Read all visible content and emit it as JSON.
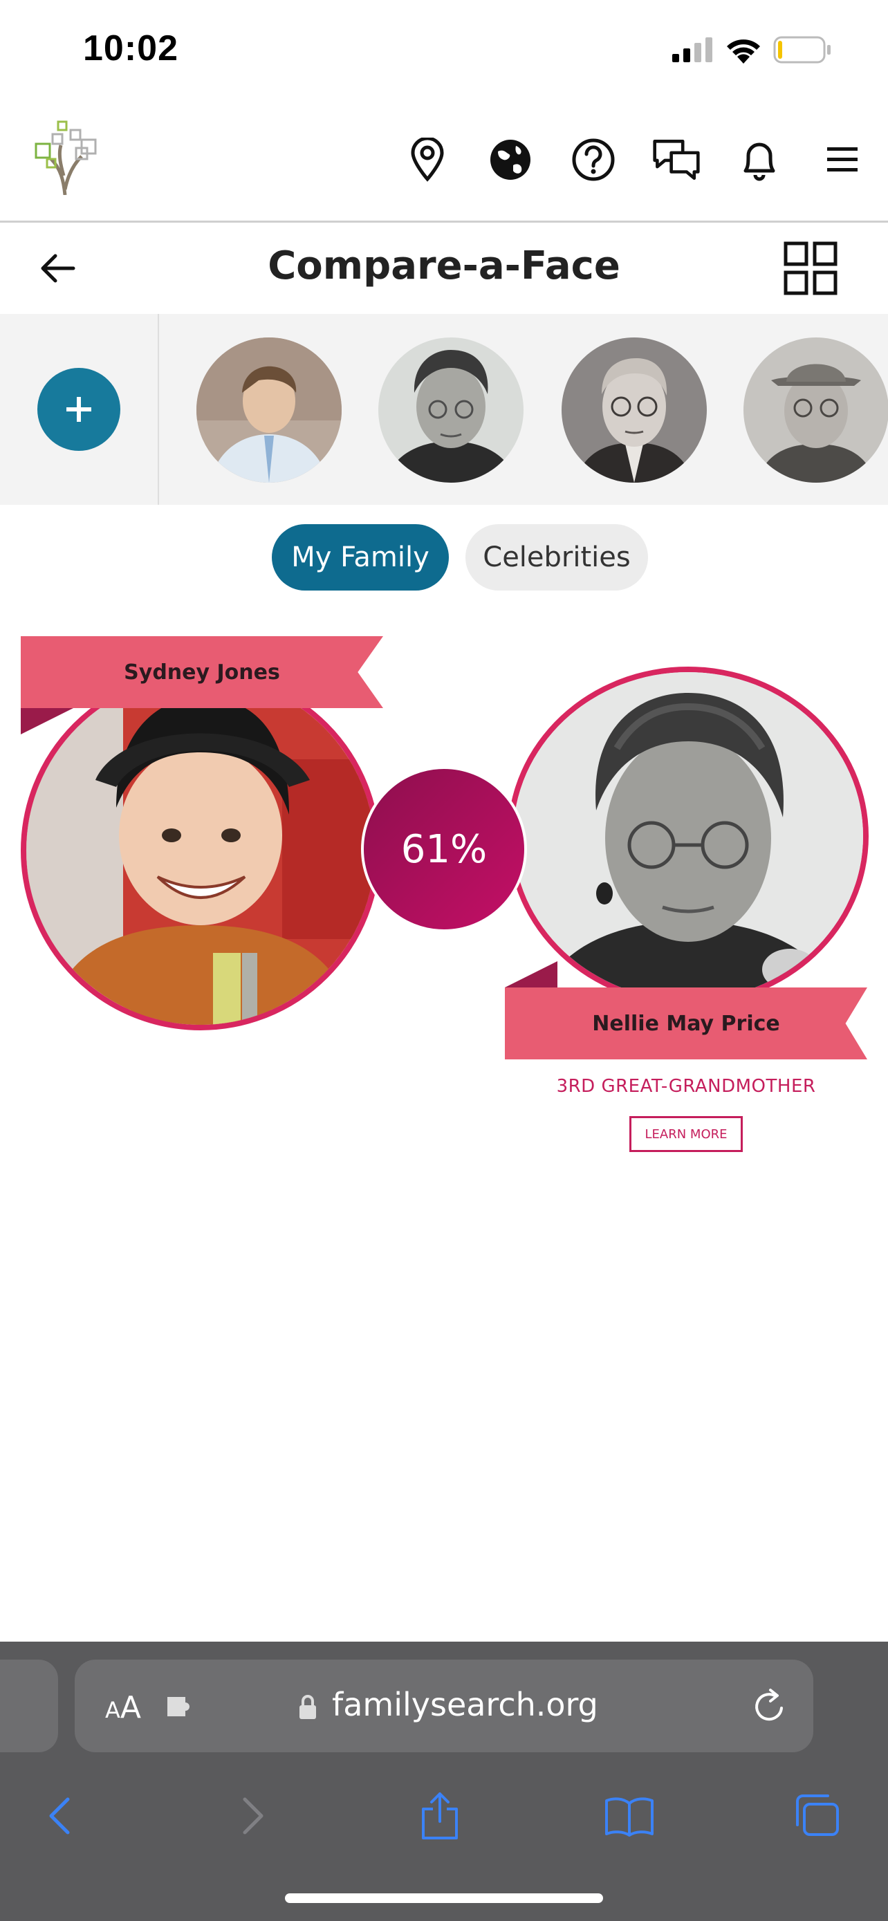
{
  "status_bar": {
    "time": "10:02"
  },
  "top_nav": {
    "icons": [
      "location-pin-icon",
      "globe-icon",
      "help-icon",
      "chat-icon",
      "bell-icon",
      "menu-icon"
    ]
  },
  "header": {
    "title": "Compare-a-Face"
  },
  "tabs": {
    "my_family": "My Family",
    "celebrities": "Celebrities"
  },
  "comparison": {
    "left_name": "Sydney Jones",
    "right_name": "Nellie May Price",
    "match_percent": "61%",
    "relationship": "3RD GREAT-GRANDMOTHER",
    "learn_more": "LEARN MORE"
  },
  "browser": {
    "aa_small": "A",
    "aa_big": "A",
    "url": "familysearch.org"
  },
  "colors": {
    "brand_teal": "#0e6b8f",
    "accent_pink": "#d8265f",
    "ribbon": "#e85c72",
    "ios_blue": "#3b82f6"
  }
}
